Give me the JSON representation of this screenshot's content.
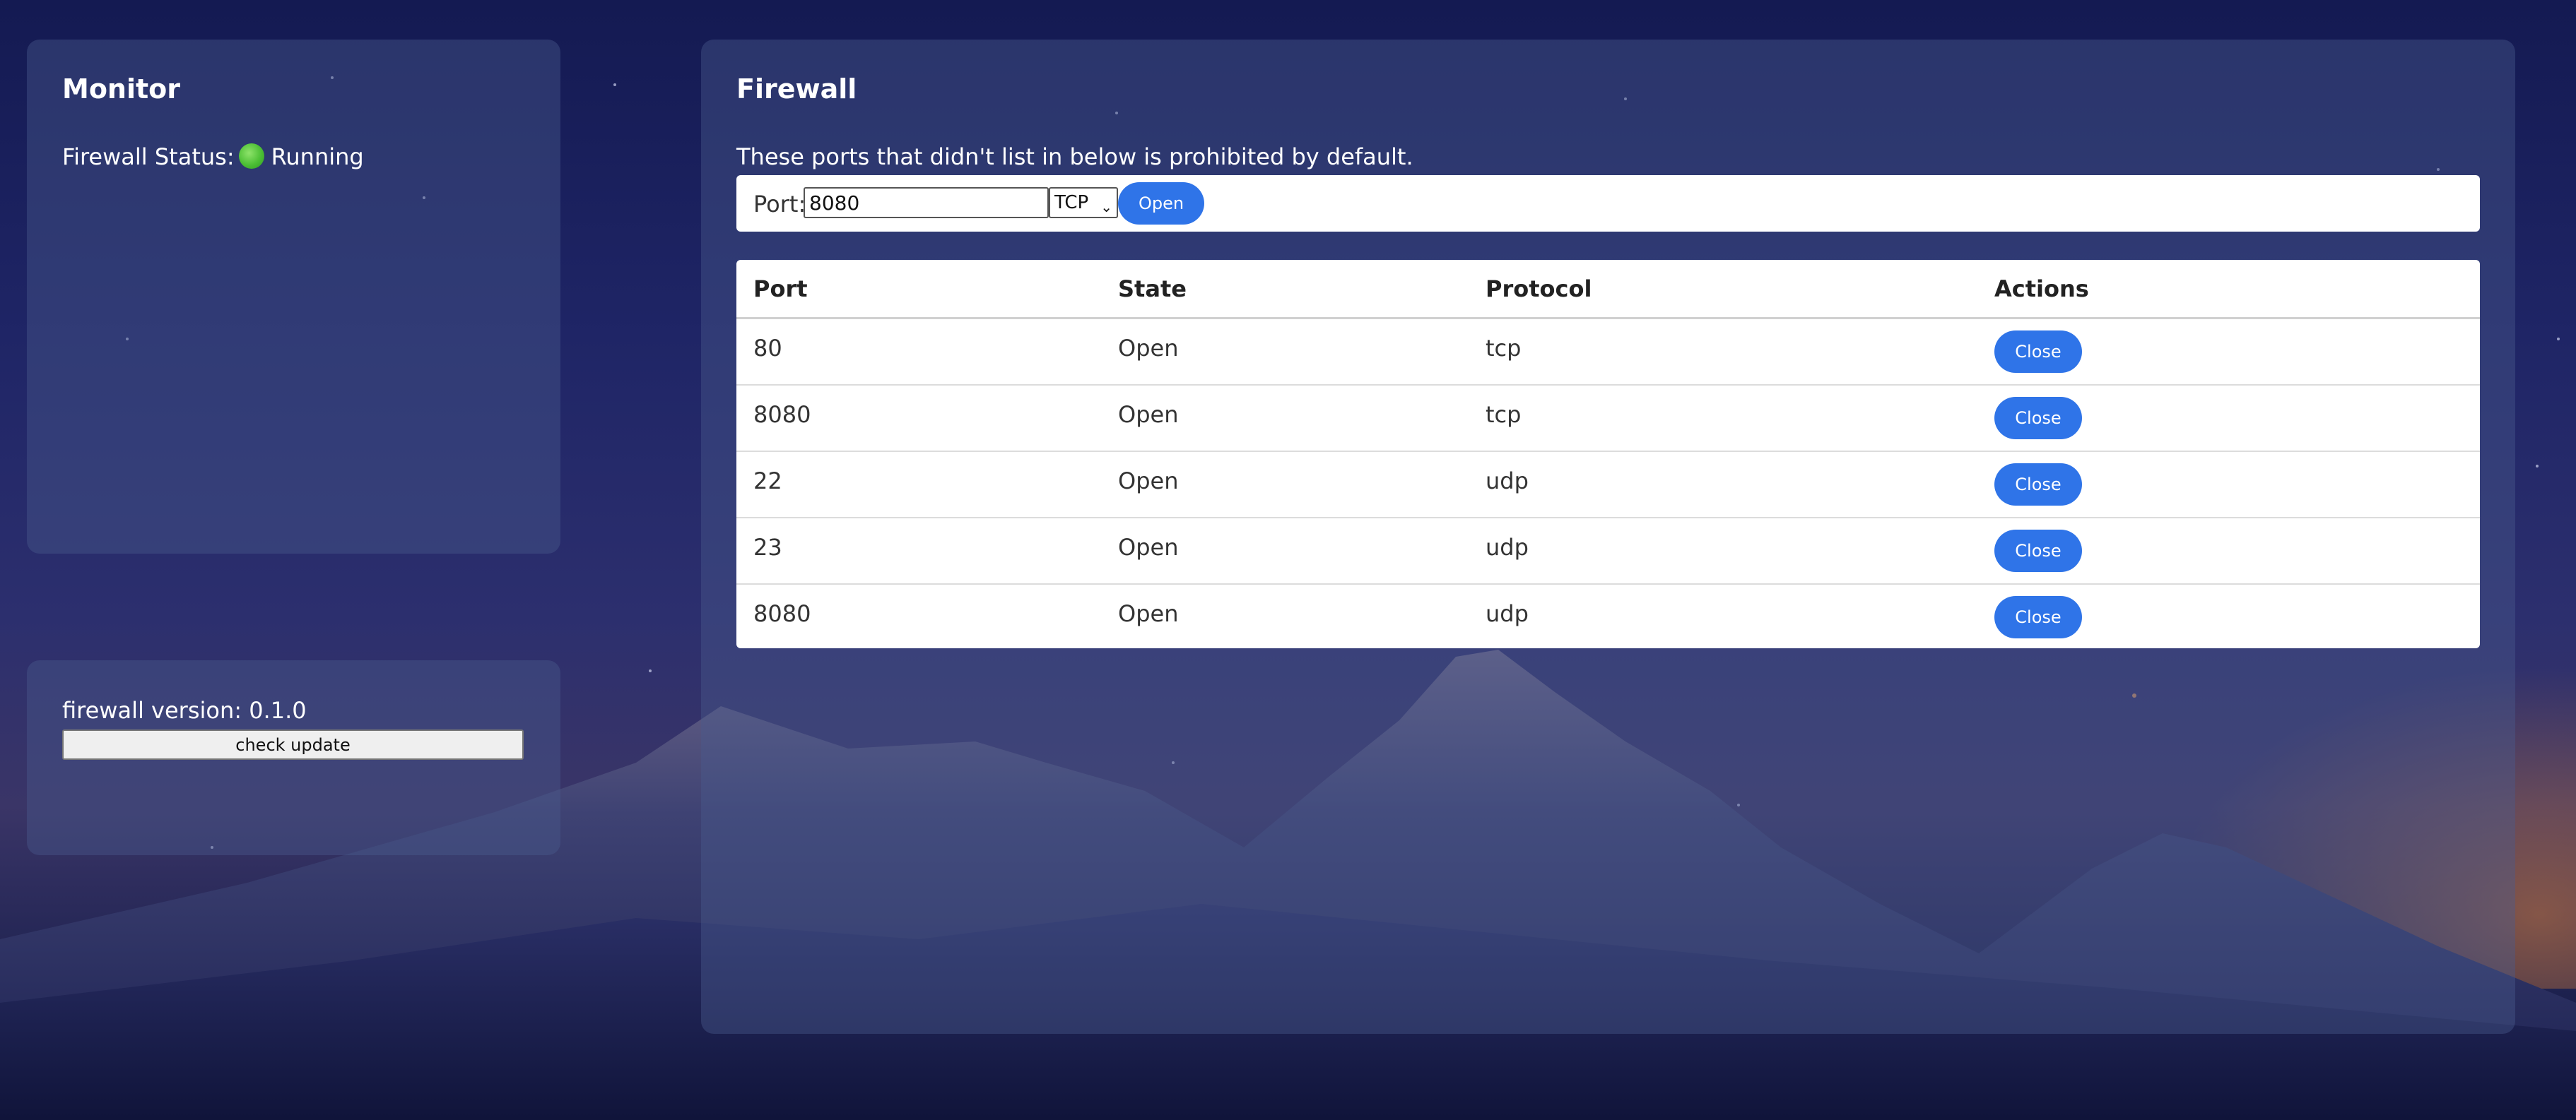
{
  "monitor": {
    "title": "Monitor",
    "status_label": "Firewall Status:",
    "status_value": "Running",
    "status_color": "#4cbf35"
  },
  "version": {
    "text": "firewall version: 0.1.0",
    "check_update_label": "check update"
  },
  "firewall": {
    "title": "Firewall",
    "description": "These ports that didn't list in below is prohibited by default.",
    "add_form": {
      "port_label": "Port:",
      "port_value": "8080",
      "protocol_selected": "TCP",
      "open_label": "Open"
    },
    "table": {
      "headers": [
        "Port",
        "State",
        "Protocol",
        "Actions"
      ],
      "rows": [
        {
          "port": "80",
          "state": "Open",
          "protocol": "tcp",
          "action": "Close"
        },
        {
          "port": "8080",
          "state": "Open",
          "protocol": "tcp",
          "action": "Close"
        },
        {
          "port": "22",
          "state": "Open",
          "protocol": "udp",
          "action": "Close"
        },
        {
          "port": "23",
          "state": "Open",
          "protocol": "udp",
          "action": "Close"
        },
        {
          "port": "8080",
          "state": "Open",
          "protocol": "udp",
          "action": "Close"
        }
      ]
    }
  },
  "colors": {
    "accent": "#2f74e8",
    "panel": "rgba(75,90,140,0.42)"
  }
}
